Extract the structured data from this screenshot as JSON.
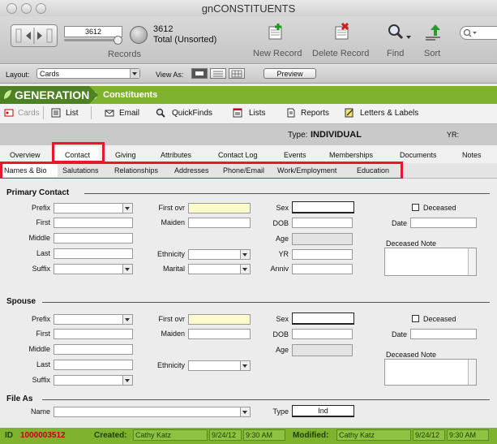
{
  "window": {
    "title": "gnCONSTITUENTS"
  },
  "toolbar": {
    "record_number": "3612",
    "records_label": "Records",
    "found_count": "3612",
    "found_status": "Total (Unsorted)",
    "new_record": "New Record",
    "delete_record": "Delete Record",
    "find": "Find",
    "sort": "Sort",
    "search_placeholder": ""
  },
  "layoutbar": {
    "layout_label": "Layout:",
    "layout_value": "Cards",
    "view_as_label": "View As:",
    "preview": "Preview"
  },
  "header": {
    "brand": "GENERATIONS",
    "page": "Constituents"
  },
  "nav": {
    "cards": "Cards",
    "list": "List",
    "email": "Email",
    "quickfinds": "QuickFinds",
    "lists": "Lists",
    "reports": "Reports",
    "letters": "Letters & Labels"
  },
  "typebar": {
    "type_label": "Type:",
    "type_value": "INDIVIDUAL",
    "yr_label": "YR:"
  },
  "tabs": [
    "Overview",
    "Contact",
    "Giving",
    "Attributes",
    "Contact Log",
    "Events",
    "Memberships",
    "Documents",
    "Notes"
  ],
  "subtabs": [
    "Names & Bio",
    "Salutations",
    "Relationships",
    "Addresses",
    "Phone/Email",
    "Work/Employment",
    "Education"
  ],
  "primary": {
    "title": "Primary Contact",
    "prefix": "Prefix",
    "first": "First",
    "middle": "Middle",
    "last": "Last",
    "suffix": "Suffix",
    "first_ovr": "First ovr",
    "maiden": "Maiden",
    "ethnicity": "Ethnicity",
    "marital": "Marital",
    "sex": "Sex",
    "dob": "DOB",
    "age": "Age",
    "yr": "YR",
    "anniv": "Anniv",
    "deceased": "Deceased",
    "date": "Date",
    "deceased_note": "Deceased Note"
  },
  "spouse": {
    "title": "Spouse",
    "prefix": "Prefix",
    "first": "First",
    "middle": "Middle",
    "last": "Last",
    "suffix": "Suffix",
    "first_ovr": "First ovr",
    "maiden": "Maiden",
    "ethnicity": "Ethnicity",
    "sex": "Sex",
    "dob": "DOB",
    "age": "Age",
    "deceased": "Deceased",
    "date": "Date",
    "deceased_note": "Deceased Note"
  },
  "fileas": {
    "title": "File As",
    "name": "Name",
    "type": "Type",
    "type_value": "Ind"
  },
  "footer": {
    "id_label": "ID",
    "id_value": "1000003512",
    "created_label": "Created:",
    "created_by": "Cathy Katz",
    "created_date": "9/24/12",
    "created_time": "9:30 AM",
    "modified_label": "Modified:",
    "modified_by": "Cathy Katz",
    "modified_date": "9/24/12",
    "modified_time": "9:30 AM"
  },
  "colors": {
    "accent_green": "#7fb32e",
    "dark_green": "#4d8221",
    "highlight_red": "#e8172b",
    "id_red": "#c0001a"
  }
}
